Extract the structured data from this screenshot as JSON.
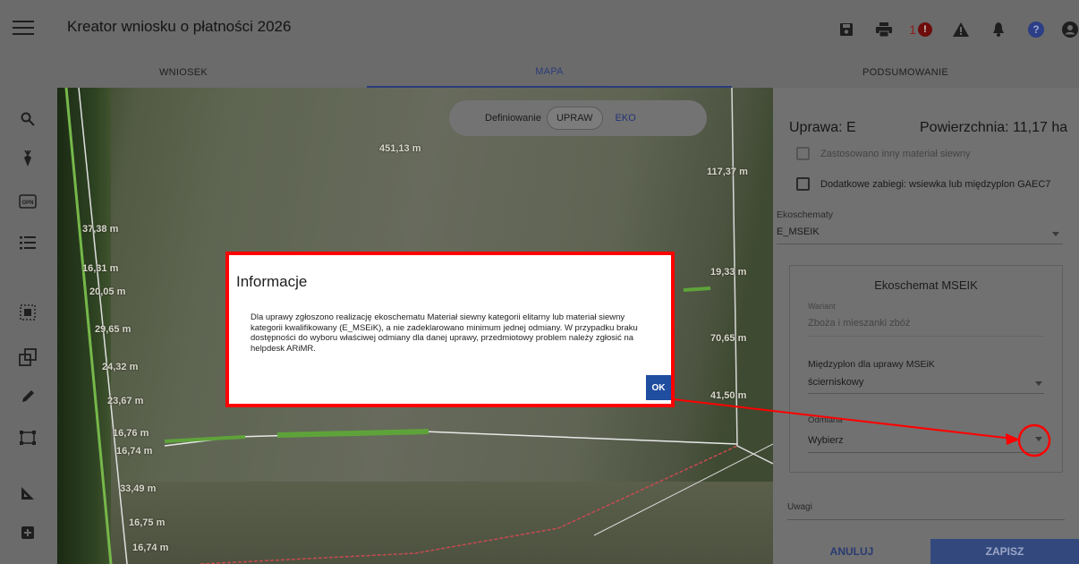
{
  "app": {
    "title": "Kreator wniosku o płatności 2026",
    "error_count": "1"
  },
  "tabs": [
    {
      "label": "WNIOSEK"
    },
    {
      "label": "MAPA"
    },
    {
      "label": "PODSUMOWANIE"
    }
  ],
  "map": {
    "toggle": {
      "prefix": "Definiowanie",
      "selected": "UPRAW",
      "other": "EKO"
    },
    "measurements": [
      "451,13 m",
      "117,37 m",
      "37,38 m",
      "16,31 m",
      "20,05 m",
      "29,65 m",
      "24,32 m",
      "23,67 m",
      "16,76 m",
      "16,74 m",
      "19,33 m",
      "70,65 m",
      "41,50 m",
      "33,49 m",
      "16,75 m",
      "16,74 m"
    ]
  },
  "panel": {
    "crop_label": "Uprawa: E",
    "area_label": "Powierzchnia: 11,17 ha",
    "checkbox_other_material": "Zastosowano inny materiał siewny",
    "checkbox_extra": "Dodatkowe zabiegi: wsiewka lub międzyplon GAEC7",
    "ecoschemes_label": "Ekoschematy",
    "ecoschemes_value": "E_MSEIK",
    "subcard": {
      "title": "Ekoschemat MSEIK",
      "variant_label": "Wariant",
      "variant_value": "Zboża i mieszanki zbóż",
      "catch_label": "Międzyplon dla uprawy MSEiK",
      "catch_value": "ścierniskowy",
      "variety_label": "Odmiana",
      "variety_value": "Wybierz"
    },
    "notes_label": "Uwagi",
    "cancel": "ANULUJ",
    "save": "ZAPISZ"
  },
  "dialog": {
    "title": "Informacje",
    "body": "Dla uprawy zgłoszono realizację ekoschematu Materiał siewny kategorii elitarny lub materiał siewny kategorii kwalifikowany (E_MSEiK), a nie zadeklarowano minimum jednej odmiany. W przypadku braku dostępności do wyboru właściwej odmiany dla danej uprawy, przedmiotowy problem należy zgłosić na helpdesk ARiMR.",
    "ok": "OK"
  },
  "colors": {
    "highlight": "#ff0000",
    "primary": "#1f4da0"
  }
}
